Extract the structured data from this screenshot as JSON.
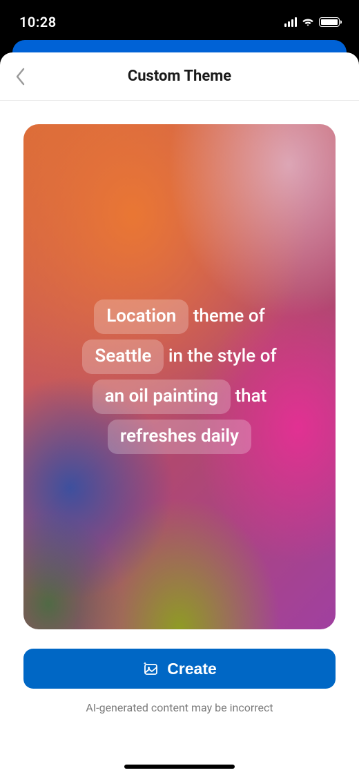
{
  "status_bar": {
    "time": "10:28"
  },
  "header": {
    "title": "Custom Theme"
  },
  "prompt": {
    "chip_category": "Location",
    "text_after_category": " theme of ",
    "chip_subject": "Seattle",
    "text_after_subject": " in the style of ",
    "chip_style": "an oil painting",
    "text_after_style": " that ",
    "chip_refresh": "refreshes daily"
  },
  "actions": {
    "create_label": "Create"
  },
  "footer": {
    "disclaimer": "AI-generated content may be incorrect"
  }
}
